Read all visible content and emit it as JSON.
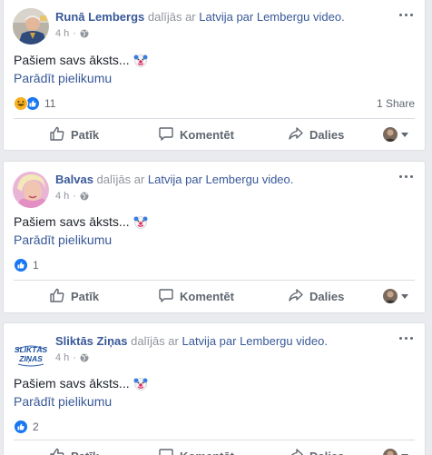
{
  "posts": [
    {
      "author": "Runā Lembergs",
      "shared_text": "dalījās ar",
      "page": "Latvija par Lembergu",
      "object": "video.",
      "time": "4 h",
      "separator": "·",
      "text": "Pašiem savs āksts...",
      "show_attachment": "Parādīt pielikumu",
      "reaction_count": "11",
      "share_count": "1 Share",
      "reactions": [
        "haha",
        "like"
      ]
    },
    {
      "author": "Balvas",
      "shared_text": "dalījās ar",
      "page": "Latvija par Lembergu",
      "object": "video.",
      "time": "4 h",
      "separator": "·",
      "text": "Pašiem savs āksts...",
      "show_attachment": "Parādīt pielikumu",
      "reaction_count": "1",
      "share_count": "",
      "reactions": [
        "like"
      ]
    },
    {
      "author": "Sliktās Ziņas",
      "shared_text": "dalījās ar",
      "page": "Latvija par Lembergu",
      "object": "video.",
      "time": "4 h",
      "separator": "·",
      "text": "Pašiem savs āksts...",
      "show_attachment": "Parādīt pielikumu",
      "reaction_count": "2",
      "share_count": "",
      "reactions": [
        "like"
      ]
    }
  ],
  "actions": {
    "like": "Patīk",
    "comment": "Komentēt",
    "share": "Dalies"
  },
  "logo_text": {
    "line1": "SLIKTĀS",
    "line2": "ZIŅAS"
  },
  "colors": {
    "link": "#385898",
    "like_blue": "#1877f2",
    "haha_yellow": "#f7b125",
    "muted": "#606770"
  },
  "icons": {
    "like": "thumbs-up-icon",
    "comment": "speech-bubble-icon",
    "share": "share-arrow-icon",
    "privacy": "globe-icon",
    "more": "more-dots-icon"
  }
}
